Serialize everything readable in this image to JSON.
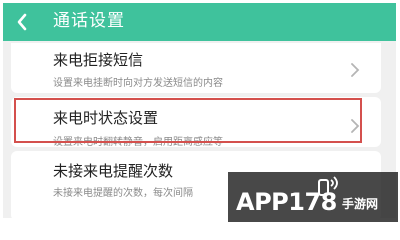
{
  "header": {
    "title": "通话设置",
    "back_icon": "chevron-left-icon",
    "color": "#3fc29c"
  },
  "settings": [
    {
      "title": "来电拒接短信",
      "description": "设置来电挂断时向对方发送短信的内容"
    },
    {
      "title": "来电时状态设置",
      "description": "设置来电时翻转静音，启用距离感应等",
      "highlighted": true,
      "highlight_color": "#d4504d"
    },
    {
      "title": "未接来电提醒次数",
      "description": "未接来电提醒的次数，每次间隔"
    }
  ],
  "watermark": {
    "text": "APP178",
    "sub": "手游网",
    "icon": "phone-signal-icon"
  }
}
